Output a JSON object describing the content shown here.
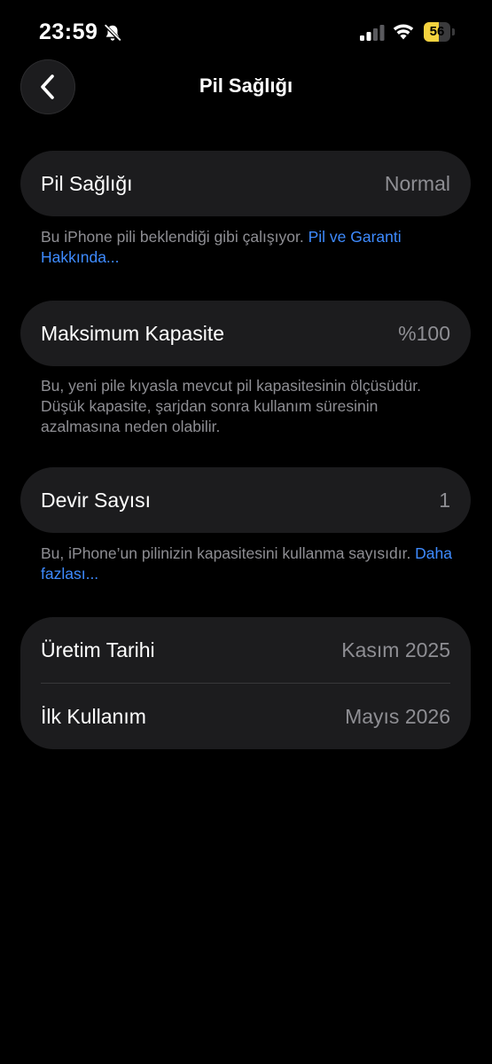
{
  "status_bar": {
    "time": "23:59",
    "battery_level": "56",
    "battery_fraction": 0.56,
    "icons": [
      "bell-slash-icon",
      "cellular-signal-icon",
      "wifi-icon",
      "battery-icon"
    ],
    "battery_color": "#f5d33f"
  },
  "nav": {
    "title": "Pil Sağlığı",
    "back_icon": "chevron-left-icon"
  },
  "sections": {
    "health": {
      "label": "Pil Sağlığı",
      "value": "Normal",
      "footnote": "Bu iPhone pili beklendiği gibi çalışıyor. ",
      "link": "Pil ve Garanti Hakkında..."
    },
    "capacity": {
      "label": "Maksimum Kapasite",
      "value": "%100",
      "footnote": "Bu, yeni pile kıyasla mevcut pil kapasitesinin ölçüsüdür. Düşük kapasite, şarjdan sonra kullanım süresinin azalmasına neden olabilir."
    },
    "cycle": {
      "label": "Devir Sayısı",
      "value": "1",
      "footnote": "Bu, iPhone’un pilinizin kapasitesini kullanma sayısıdır. ",
      "link": "Daha fazlası..."
    },
    "dates": {
      "manufacture_label": "Üretim Tarihi",
      "manufacture_value": "Kasım 2025",
      "first_use_label": "İlk Kullanım",
      "first_use_value": "Mayıs 2026"
    }
  },
  "colors": {
    "background": "#000000",
    "card": "#1c1c1e",
    "secondary_text": "#8e8e93",
    "link": "#3e8bff"
  }
}
